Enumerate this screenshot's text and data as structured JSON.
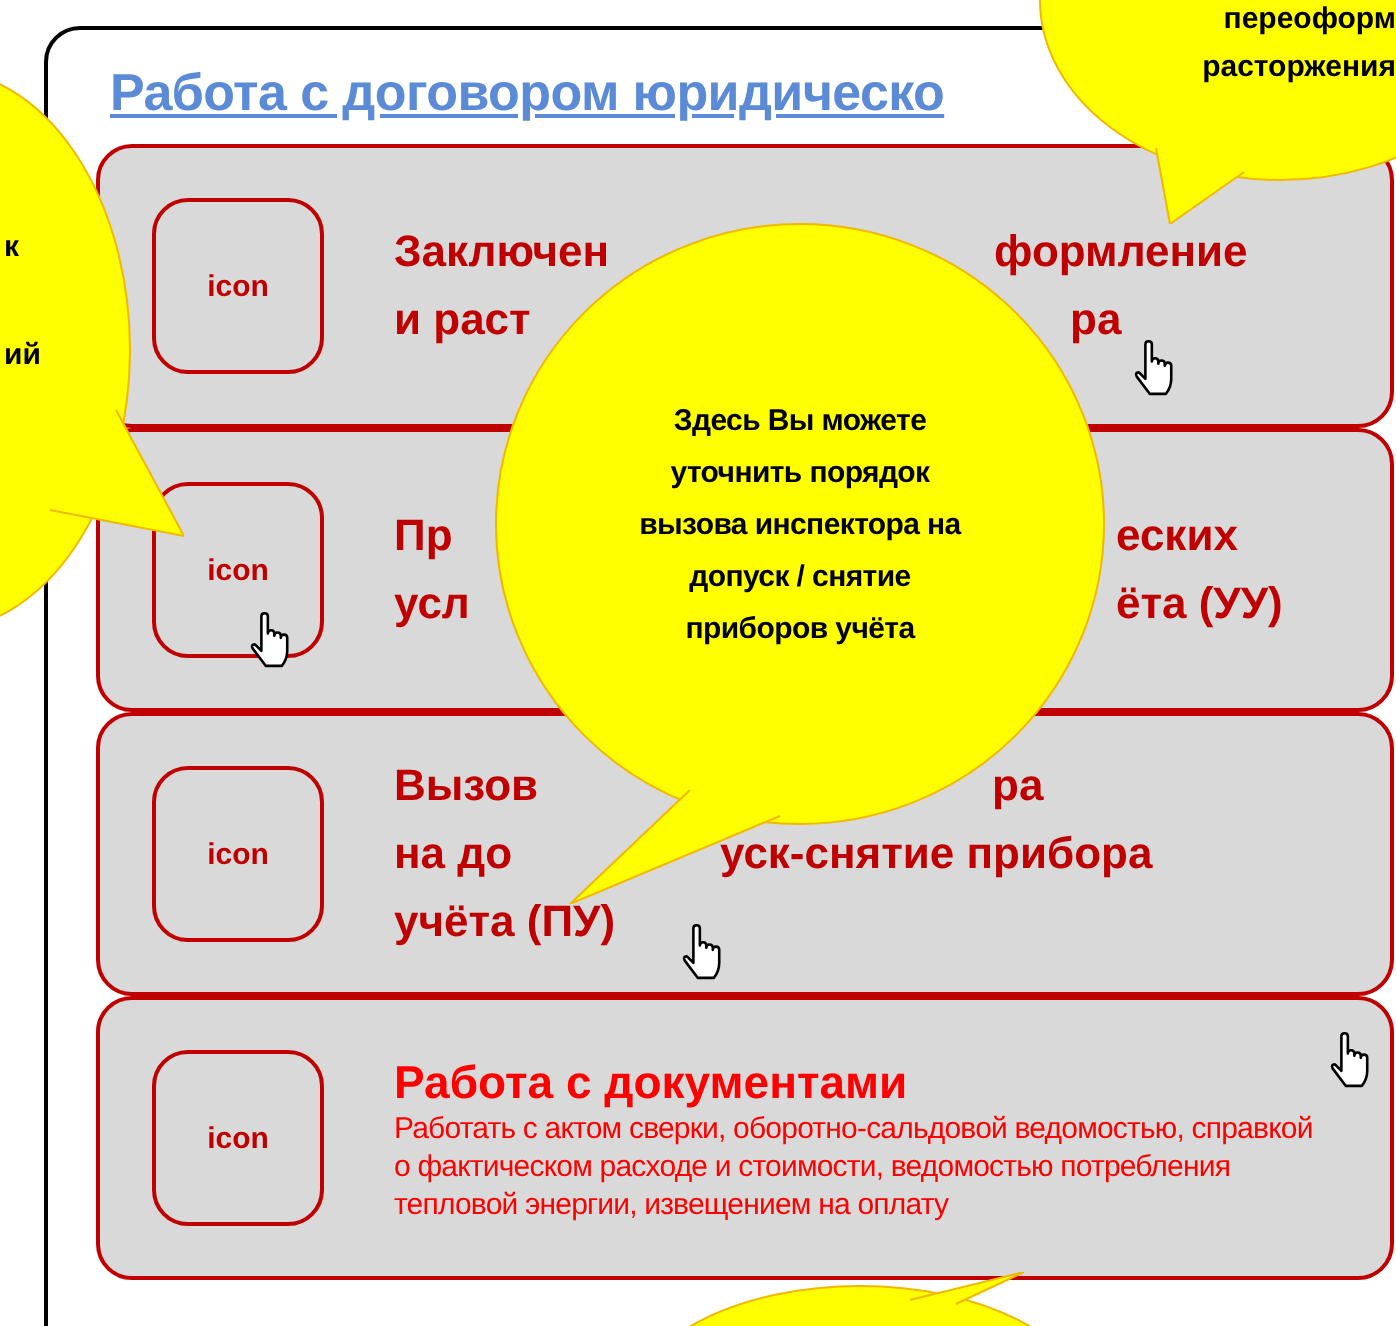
{
  "title": "Работа с договором юридическо",
  "cards": [
    {
      "kind": "heading",
      "icon": "icon",
      "lines": [
        [
          "Заключен",
          "формление"
        ],
        [
          "и раст",
          "ра"
        ]
      ]
    },
    {
      "kind": "heading",
      "icon": "icon",
      "lines": [
        [
          "Пр",
          "еских"
        ],
        [
          "усл",
          "ёта (УУ)"
        ]
      ]
    },
    {
      "kind": "heading",
      "icon": "icon",
      "lines": [
        [
          "Вызов",
          "ра"
        ],
        [
          "на до",
          "уск-снятие прибора"
        ],
        [
          "учёта (ПУ)"
        ]
      ]
    },
    {
      "kind": "document",
      "icon": "icon",
      "title": "Работа с документами",
      "description": "Работать с актом сверки, оборотно-сальдовой ведомостью, справкой о фактическом расходе и стоимости, ведомостью потребления тепловой энергии, извещением на оплату"
    }
  ],
  "callouts": [
    {
      "kind": "left",
      "lines": [
        "к",
        "ий"
      ]
    },
    {
      "kind": "top-right",
      "lines": [
        "переоформ",
        "расторжения"
      ]
    },
    {
      "kind": "center",
      "text": "Здесь Вы можете уточнить порядок вызова инспектора на допуск / снятие приборов учёта"
    },
    {
      "kind": "bottom"
    }
  ]
}
